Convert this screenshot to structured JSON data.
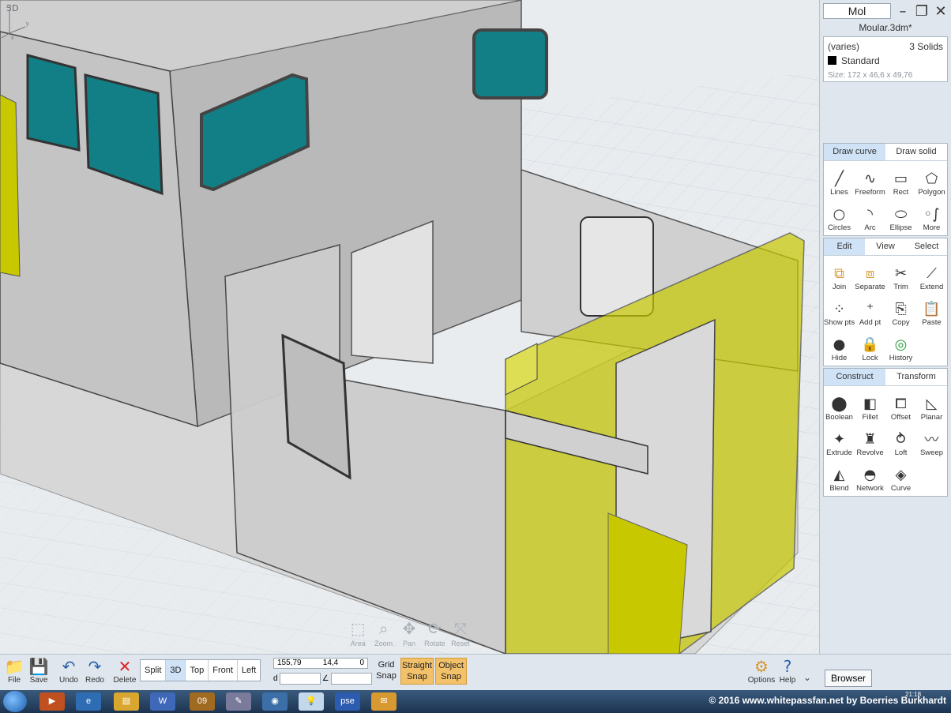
{
  "viewport": {
    "label": "3D",
    "nav": [
      {
        "label": "Area",
        "icon": "area-zoom-icon"
      },
      {
        "label": "Zoom",
        "icon": "zoom-icon"
      },
      {
        "label": "Pan",
        "icon": "pan-icon"
      },
      {
        "label": "Rotate",
        "icon": "rotate-icon"
      },
      {
        "label": "Reset",
        "icon": "reset-icon"
      }
    ],
    "colors": {
      "background": "#e9ecef",
      "grid": "#c9d7e3",
      "walls": "#c8c8c8",
      "walls_dark": "#a9a9a9",
      "glass": "#127f86",
      "yellow": "#c8c800"
    }
  },
  "panel": {
    "mode": "Mol",
    "filename": "Moular.3dm*",
    "props": {
      "layer": "(varies)",
      "count": "3 Solids",
      "material": "Standard",
      "size": "Size:  172 x 46,6 x 49,76"
    },
    "draw": {
      "tabs": [
        "Draw curve",
        "Draw solid"
      ],
      "tools": [
        "Lines",
        "Freeform",
        "Rect",
        "Polygon",
        "Circles",
        "Arc",
        "Ellipse",
        "More"
      ]
    },
    "edit": {
      "tabs": [
        "Edit",
        "View",
        "Select"
      ],
      "tools": [
        "Join",
        "Separate",
        "Trim",
        "Extend",
        "Show pts",
        "Add pt",
        "Copy",
        "Paste",
        "Hide",
        "Lock",
        "History"
      ]
    },
    "construct": {
      "tabs": [
        "Construct",
        "Transform"
      ],
      "tools": [
        "Boolean",
        "Fillet",
        "Offset",
        "Planar",
        "Extrude",
        "Revolve",
        "Loft",
        "Sweep",
        "Blend",
        "Network",
        "Curve"
      ]
    }
  },
  "toolbar": {
    "buttons": [
      "File",
      "Save",
      "Undo",
      "Redo",
      "Delete"
    ],
    "views": [
      "Split",
      "3D",
      "Top",
      "Front",
      "Left"
    ],
    "active_view": "3D",
    "coords": {
      "x": "155,79",
      "y": "14,4",
      "z": "0",
      "d_label": "d"
    },
    "grid_snap": "Grid\nSnap",
    "straight_snap": "Straight\nSnap",
    "object_snap": "Object\nSnap",
    "options": "Options",
    "help": "Help",
    "browser": "Browser"
  },
  "taskbar": {
    "apps": [
      "media",
      "ie",
      "explorer",
      "word",
      "2009",
      "paint",
      "network",
      "moi",
      "pse",
      "mail"
    ],
    "credit": "© 2016 www.whitepassfan.net by Boerries Burkhardt",
    "time": "21:18"
  }
}
